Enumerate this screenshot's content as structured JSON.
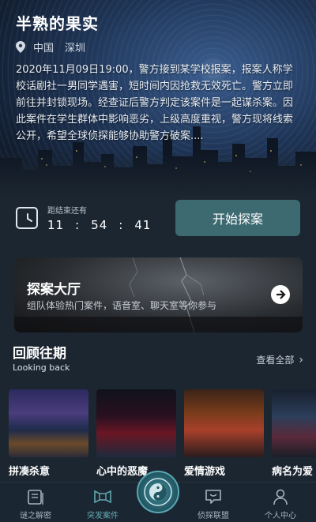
{
  "hero": {
    "title": "半熟的果实",
    "location_country": "中国",
    "location_city": "深圳",
    "description": "2020年11月09日19:00，警方接到某学校报案，报案人称学校话剧社一男同学遇害，短时间内因抢救无效死亡。警方立即前往并封锁现场。经查证后警方判定该案件是一起谋杀案。因此案件在学生群体中影响恶劣，上级高度重视，警方现将线索公开，希望全球侦探能够协助警方破案...."
  },
  "countdown": {
    "label": "距结束还有",
    "hours": "11",
    "minutes": "54",
    "seconds": "41",
    "separator": ":"
  },
  "start_button_label": "开始探案",
  "hall": {
    "title": "探案大厅",
    "subtitle": "组队体验热门案件，语音室、聊天室等你参与"
  },
  "review": {
    "title": "回顾往期",
    "subtitle": "Looking back",
    "view_all_label": "查看全部",
    "cards": [
      {
        "label": "拼凑杀意"
      },
      {
        "label": "心中的恶魔"
      },
      {
        "label": "爱情游戏"
      },
      {
        "label": "病名为爱"
      }
    ]
  },
  "bottom_nav": {
    "items": [
      {
        "label": "谜之解密",
        "icon": "book-icon"
      },
      {
        "label": "突发案件",
        "icon": "film-icon",
        "active": true
      },
      {
        "label": "侦探联盟",
        "icon": "chat-icon"
      },
      {
        "label": "个人中心",
        "icon": "user-icon"
      }
    ],
    "center_icon": "yin-yang-icon"
  },
  "colors": {
    "accent": "#3c6a70",
    "active_nav": "#63a8b0",
    "background": "#1c2631"
  }
}
